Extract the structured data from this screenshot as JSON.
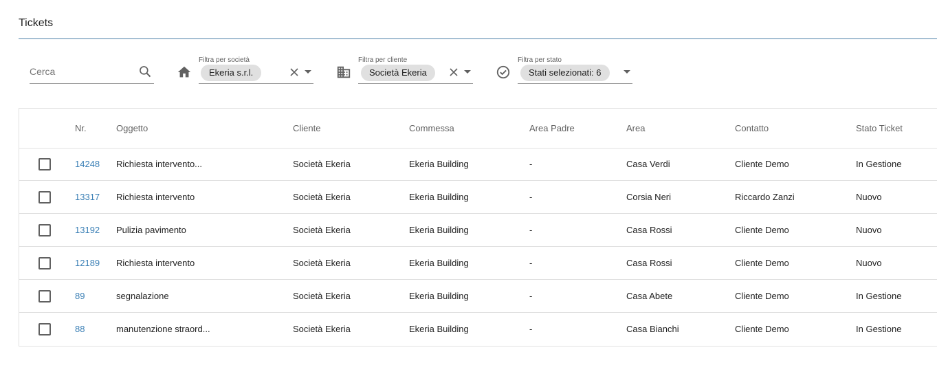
{
  "page": {
    "title": "Tickets"
  },
  "filters": {
    "search": {
      "placeholder": "Cerca"
    },
    "societa": {
      "label": "Filtra per società",
      "value": "Ekeria s.r.l."
    },
    "cliente": {
      "label": "Filtra per cliente",
      "value": "Società Ekeria"
    },
    "stato": {
      "label": "Filtra per stato",
      "value": "Stati selezionati: 6"
    }
  },
  "table": {
    "headers": [
      "Nr.",
      "Oggetto",
      "Cliente",
      "Commessa",
      "Area Padre",
      "Area",
      "Contatto",
      "Stato Ticket"
    ],
    "rows": [
      {
        "nr": "14248",
        "oggetto": "Richiesta intervento...",
        "cliente": "Società Ekeria",
        "commessa": "Ekeria Building",
        "area_padre": "-",
        "area": "Casa Verdi",
        "contatto": "Cliente Demo",
        "stato": "In Gestione"
      },
      {
        "nr": "13317",
        "oggetto": "Richiesta intervento",
        "cliente": "Società Ekeria",
        "commessa": "Ekeria Building",
        "area_padre": "-",
        "area": "Corsia Neri",
        "contatto": "Riccardo Zanzi",
        "stato": "Nuovo"
      },
      {
        "nr": "13192",
        "oggetto": "Pulizia pavimento",
        "cliente": "Società Ekeria",
        "commessa": "Ekeria Building",
        "area_padre": "-",
        "area": "Casa Rossi",
        "contatto": "Cliente Demo",
        "stato": "Nuovo"
      },
      {
        "nr": "12189",
        "oggetto": "Richiesta intervento",
        "cliente": "Società Ekeria",
        "commessa": "Ekeria Building",
        "area_padre": "-",
        "area": "Casa Rossi",
        "contatto": "Cliente Demo",
        "stato": "Nuovo"
      },
      {
        "nr": "89",
        "oggetto": "segnalazione",
        "cliente": "Società Ekeria",
        "commessa": "Ekeria Building",
        "area_padre": "-",
        "area": "Casa Abete",
        "contatto": "Cliente Demo",
        "stato": "In Gestione"
      },
      {
        "nr": "88",
        "oggetto": "manutenzione straord...",
        "cliente": "Società Ekeria",
        "commessa": "Ekeria Building",
        "area_padre": "-",
        "area": "Casa Bianchi",
        "contatto": "Cliente Demo",
        "stato": "In Gestione"
      }
    ]
  },
  "icons": {
    "search": "search-icon",
    "societa": "home-icon",
    "cliente": "building-icon",
    "stato": "check-circle-icon",
    "clear": "close-icon",
    "dropdown": "arrow-drop-down-icon"
  },
  "colors": {
    "accent": "#3a7fb5",
    "title_line": "#4a7ea6",
    "chip": "#e0e0e0"
  }
}
